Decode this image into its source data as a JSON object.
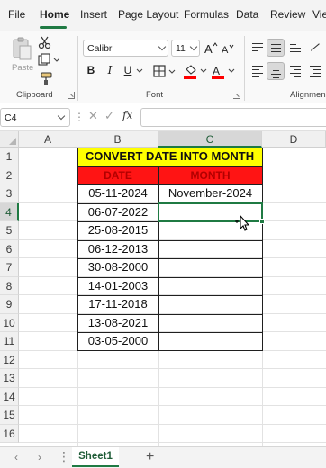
{
  "menu": {
    "tabs": [
      {
        "label": "File"
      },
      {
        "label": "Home",
        "active": true
      },
      {
        "label": "Insert"
      },
      {
        "label": "Page Layout"
      },
      {
        "label": "Formulas"
      },
      {
        "label": "Data"
      },
      {
        "label": "Review"
      },
      {
        "label": "Vie"
      }
    ]
  },
  "ribbon": {
    "clipboard": {
      "paste_label": "Paste",
      "group_label": "Clipboard",
      "icons": [
        "paste-icon",
        "cut-icon",
        "copy-icon",
        "format-painter-icon"
      ]
    },
    "font": {
      "font_name": "Calibri",
      "font_size": "11",
      "bold": "B",
      "italic": "I",
      "underline": "U",
      "group_label": "Font",
      "icons": [
        "increase-font-icon",
        "decrease-font-icon",
        "borders-icon",
        "fill-color-icon",
        "font-color-icon"
      ]
    },
    "alignment": {
      "group_label": "Alignmen"
    }
  },
  "formula_bar": {
    "name_box": "C4",
    "fx_label": "fx",
    "formula": ""
  },
  "grid": {
    "columns": [
      "A",
      "B",
      "C",
      "D"
    ],
    "selected_column": "C",
    "rows": [
      "1",
      "2",
      "3",
      "4",
      "5",
      "6",
      "7",
      "8",
      "9",
      "10",
      "11",
      "12",
      "13",
      "14",
      "15",
      "16"
    ],
    "selected_row": "4",
    "title": "CONVERT DATE INTO MONTH",
    "headers": {
      "date": "DATE",
      "month": "MONTH"
    },
    "data": [
      {
        "date": "05-11-2024",
        "month": "November-2024"
      },
      {
        "date": "06-07-2022",
        "month": ""
      },
      {
        "date": "25-08-2015",
        "month": ""
      },
      {
        "date": "06-12-2013",
        "month": ""
      },
      {
        "date": "30-08-2000",
        "month": ""
      },
      {
        "date": "14-01-2003",
        "month": ""
      },
      {
        "date": "17-11-2018",
        "month": ""
      },
      {
        "date": "13-08-2021",
        "month": ""
      },
      {
        "date": "03-05-2000",
        "month": ""
      }
    ],
    "colors": {
      "title_fill": "#ffff00",
      "header_fill": "#ff1414",
      "header_text": "#b20000",
      "selection": "#1f7a43"
    }
  },
  "sheets": {
    "tabs": [
      "Sheet1"
    ],
    "active": "Sheet1",
    "add_label": "+"
  }
}
